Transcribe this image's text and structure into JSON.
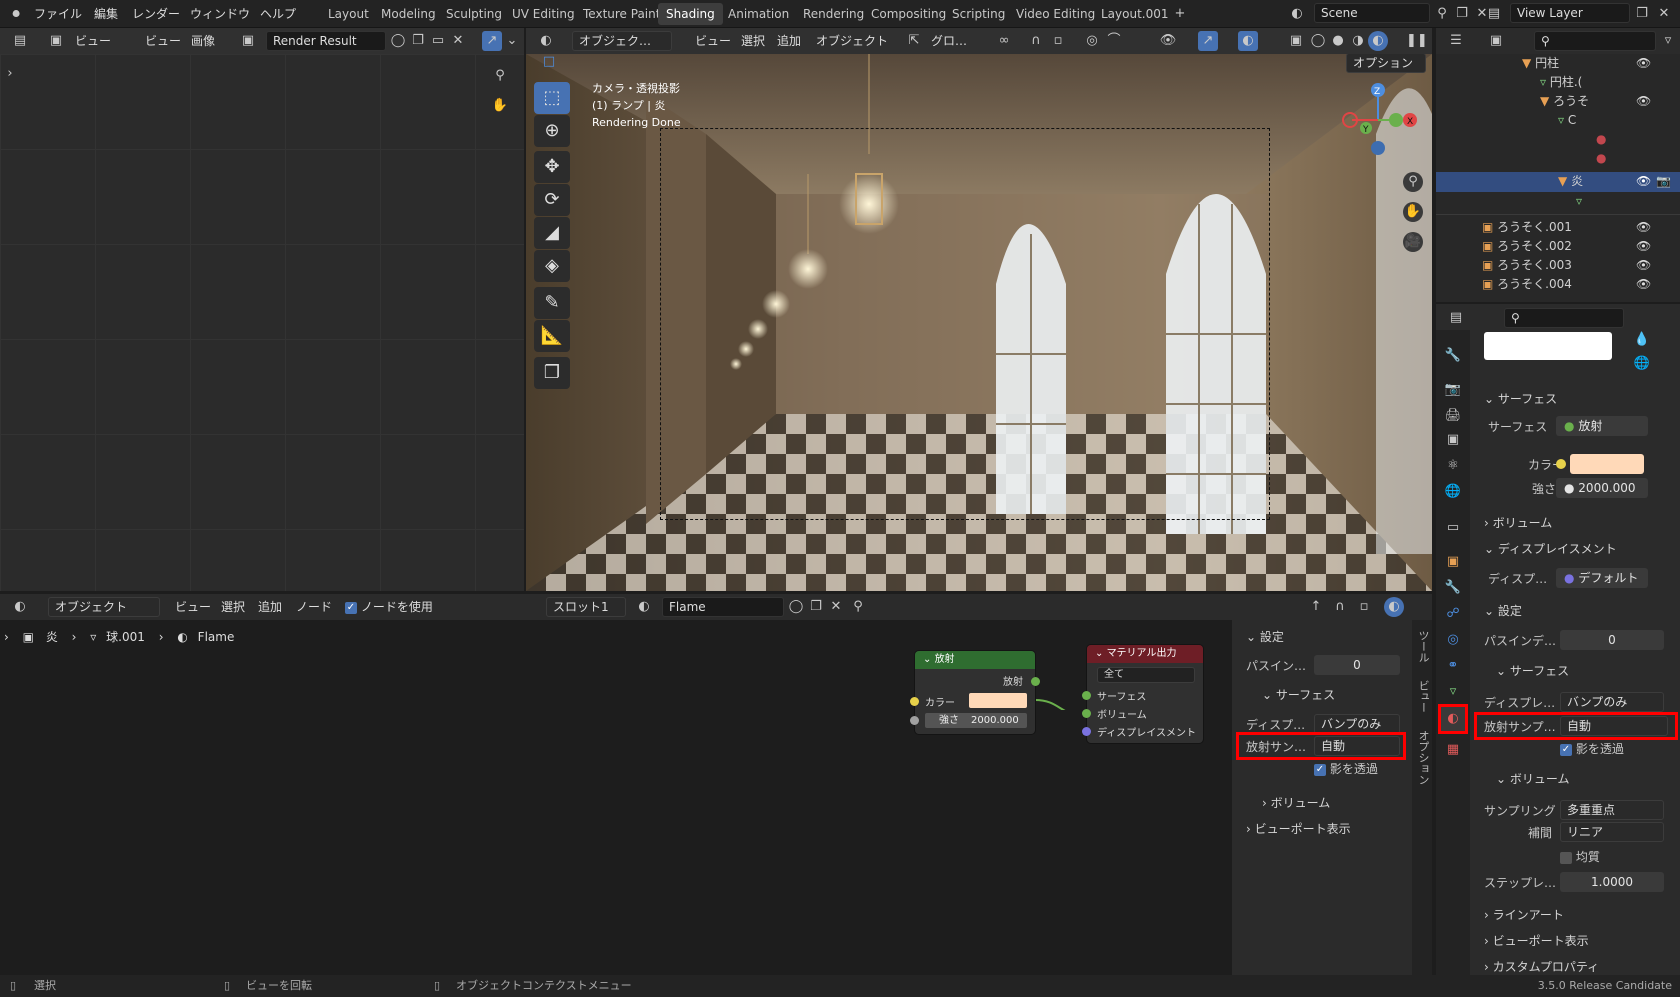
{
  "menu": [
    "ファイル",
    "編集",
    "レンダー",
    "ウィンドウ",
    "ヘルプ"
  ],
  "workspaces": [
    "Layout",
    "Modeling",
    "Sculpting",
    "UV Editing",
    "Texture Paint",
    "Shading",
    "Animation",
    "Rendering",
    "Compositing",
    "Scripting",
    "Video Editing",
    "Layout.001"
  ],
  "active_workspace": "Shading",
  "scene": "Scene",
  "view_layer": "View Layer",
  "image_editor": {
    "view": "ビュー",
    "view2": "ビュー",
    "image": "画像",
    "image_name": "Render Result"
  },
  "viewport": {
    "mode": "オブジェク…",
    "view": "ビュー",
    "select": "選択",
    "add": "追加",
    "object": "オブジェクト",
    "global": "グロ…",
    "options": "オプション",
    "overlay_line1": "カメラ・透視投影",
    "overlay_line2": "(1) ランプ | 炎",
    "overlay_line3": "Rendering Done",
    "gizmo": {
      "z": "Z",
      "y": "Y",
      "x": "X"
    }
  },
  "node_editor": {
    "mode": "オブジェクト",
    "view": "ビュー",
    "select": "選択",
    "add": "追加",
    "node": "ノード",
    "use_nodes": "ノードを使用",
    "slot": "スロット1",
    "material": "Flame",
    "breadcrumb": [
      "炎",
      "球.001",
      "Flame"
    ],
    "emission_node": {
      "title": "放射",
      "output": "放射",
      "color_label": "カラー",
      "strength_label": "強さ",
      "strength": "2000.000"
    },
    "output_node": {
      "title": "マテリアル出力",
      "target": "全て",
      "surface": "サーフェス",
      "volume": "ボリューム",
      "displacement": "ディスプレイスメント"
    }
  },
  "node_sidebar": {
    "settings": "設定",
    "pass_index_label": "パスイン…",
    "pass_index": "0",
    "surface": "サーフェス",
    "displacement_label": "ディスプ…",
    "displacement": "バンプのみ",
    "emission_sampling_label": "放射サン…",
    "emission_sampling": "自動",
    "transparent_shadow": "影を透過",
    "volume": "ボリューム",
    "viewport_display": "ビューポート表示",
    "tabs": [
      "ツール",
      "ビュー",
      "オプション"
    ]
  },
  "outliner": {
    "rows": [
      {
        "label": "円柱",
        "indent": 0
      },
      {
        "label": "円柱.(",
        "indent": 1
      },
      {
        "label": "ろうそ",
        "indent": 1
      },
      {
        "label": "C",
        "indent": 2
      },
      {
        "label": "",
        "indent": 3
      },
      {
        "label": "",
        "indent": 3
      },
      {
        "label": "炎",
        "indent": 2
      },
      {
        "label": "",
        "indent": 3
      },
      {
        "label": "ろうそく.001",
        "indent": 0
      },
      {
        "label": "ろうそく.002",
        "indent": 0
      },
      {
        "label": "ろうそく.003",
        "indent": 0
      },
      {
        "label": "ろうそく.004",
        "indent": 0
      }
    ]
  },
  "properties": {
    "surface_header": "サーフェス",
    "surface_label": "サーフェス",
    "surface_value": "放射",
    "color_label": "カラー",
    "strength_label": "強さ",
    "strength_value": "2000.000",
    "volume": "ボリューム",
    "displacement_header": "ディスプレイスメント",
    "displacement_label": "ディスプ…",
    "displacement_value": "デフォルト",
    "settings": "設定",
    "pass_index_label": "パスインデ…",
    "pass_index": "0",
    "sub_surface": "サーフェス",
    "displacement_method_label": "ディスプレ…",
    "displacement_method": "バンプのみ",
    "emission_sampling_label": "放射サンプ…",
    "emission_sampling": "自動",
    "transparent_shadow": "影を透過",
    "sub_volume": "ボリューム",
    "sampling_label": "サンプリング",
    "sampling": "多重重点",
    "interp_label": "補間",
    "interp": "リニア",
    "homogeneous": "均質",
    "step_label": "ステップレ…",
    "step": "1.0000",
    "lineart": "ラインアート",
    "viewport_display": "ビューポート表示",
    "custom_props": "カスタムプロパティ"
  },
  "statusbar": {
    "select": "選択",
    "rotate": "ビューを回転",
    "context": "オブジェクトコンテクストメニュー",
    "version": "3.5.0 Release Candidate"
  },
  "colors": {
    "accent": "#4772b3",
    "emission_color": "#ffd9b8",
    "highlight": "#ff0000",
    "emission_node": "#2f6d30",
    "output_node": "#6e1e26"
  }
}
